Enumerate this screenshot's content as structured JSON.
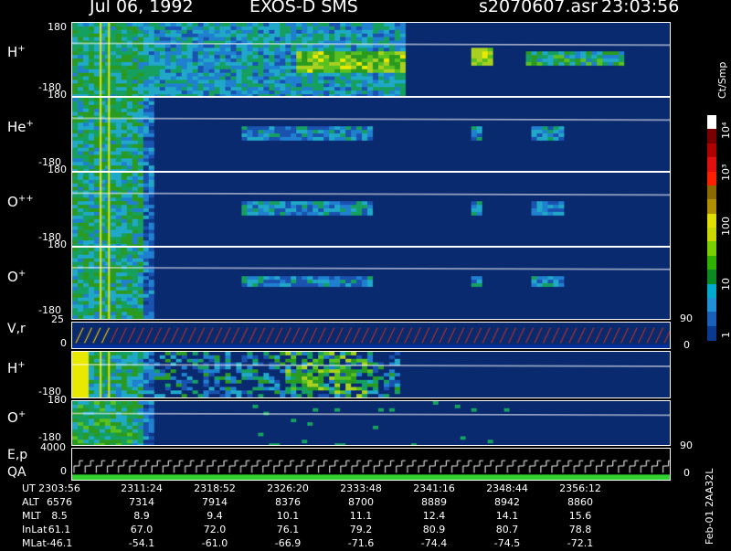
{
  "header": {
    "date": "Jul 06, 1992",
    "instrument": "EXOS-D SMS",
    "file": "s2070607.asr",
    "time": "23:03:56"
  },
  "panels": [
    {
      "id": "h_plus_1",
      "label": "H",
      "charge": "+",
      "ytop": "180",
      "ybot": "-180",
      "kind": "ion",
      "intensity": 0.55
    },
    {
      "id": "he_plus",
      "label": "He",
      "charge": "+",
      "ytop": "180",
      "ybot": "-180",
      "kind": "ion",
      "intensity": 0.2
    },
    {
      "id": "o_plusplus",
      "label": "O",
      "charge": "++",
      "ytop": "180",
      "ybot": "-180",
      "kind": "ion",
      "intensity": 0.18
    },
    {
      "id": "o_plus_1",
      "label": "O",
      "charge": "+",
      "ytop": "180",
      "ybot": "-180",
      "kind": "ion",
      "intensity": 0.2
    },
    {
      "id": "vr",
      "label": "V,r",
      "charge": "",
      "ytop": "25",
      "ybot": "0",
      "kind": "sawtooth",
      "right_tick": "90",
      "right_tick2": "0"
    },
    {
      "id": "h_plus_2",
      "label": "H",
      "charge": "+",
      "ytop": "",
      "ybot": "-180",
      "kind": "ion2",
      "intensity": 0.45
    },
    {
      "id": "o_plus_2",
      "label": "O",
      "charge": "+",
      "ytop": "180",
      "ybot": "-180",
      "kind": "ion3",
      "intensity": 0.2,
      "right_tick": "90"
    },
    {
      "id": "ep",
      "label": "E,p",
      "label2": "QA",
      "charge": "",
      "ytop": "4000",
      "ybot": "0",
      "kind": "steps",
      "right_tick": "0"
    }
  ],
  "colorbar": {
    "unit": "Ct/Smp",
    "ticks": [
      "10⁴",
      "10³",
      "100",
      "10",
      "1"
    ],
    "colors": [
      "#ffffff",
      "#7a0000",
      "#b00000",
      "#e01010",
      "#ff2000",
      "#8b6a00",
      "#b09000",
      "#e0e000",
      "#c8d800",
      "#78d000",
      "#30b000",
      "#0a8a20",
      "#00aacc",
      "#2090d8",
      "#1860b8",
      "#0a3a90"
    ]
  },
  "time_table": {
    "rows": [
      {
        "name": "UT",
        "values": [
          "2303:56",
          "2311:24",
          "2318:52",
          "2326:20",
          "2333:48",
          "2341:16",
          "2348:44",
          "2356:12"
        ]
      },
      {
        "name": "ALT",
        "values": [
          "6576",
          "7314",
          "7914",
          "8376",
          "8700",
          "8889",
          "8942",
          "8860"
        ]
      },
      {
        "name": "MLT",
        "values": [
          "8.5",
          "8.9",
          "9.4",
          "10.1",
          "11.1",
          "12.4",
          "14.1",
          "15.6"
        ]
      },
      {
        "name": "InLat",
        "values": [
          "61.1",
          "67.0",
          "72.0",
          "76.1",
          "79.2",
          "80.9",
          "80.7",
          "78.8"
        ]
      },
      {
        "name": "MLat",
        "values": [
          "-46.1",
          "-54.1",
          "-61.0",
          "-66.9",
          "-71.6",
          "-74.4",
          "-74.5",
          "-72.1"
        ]
      }
    ]
  },
  "side_text": "Feb-01 2AA32L"
}
